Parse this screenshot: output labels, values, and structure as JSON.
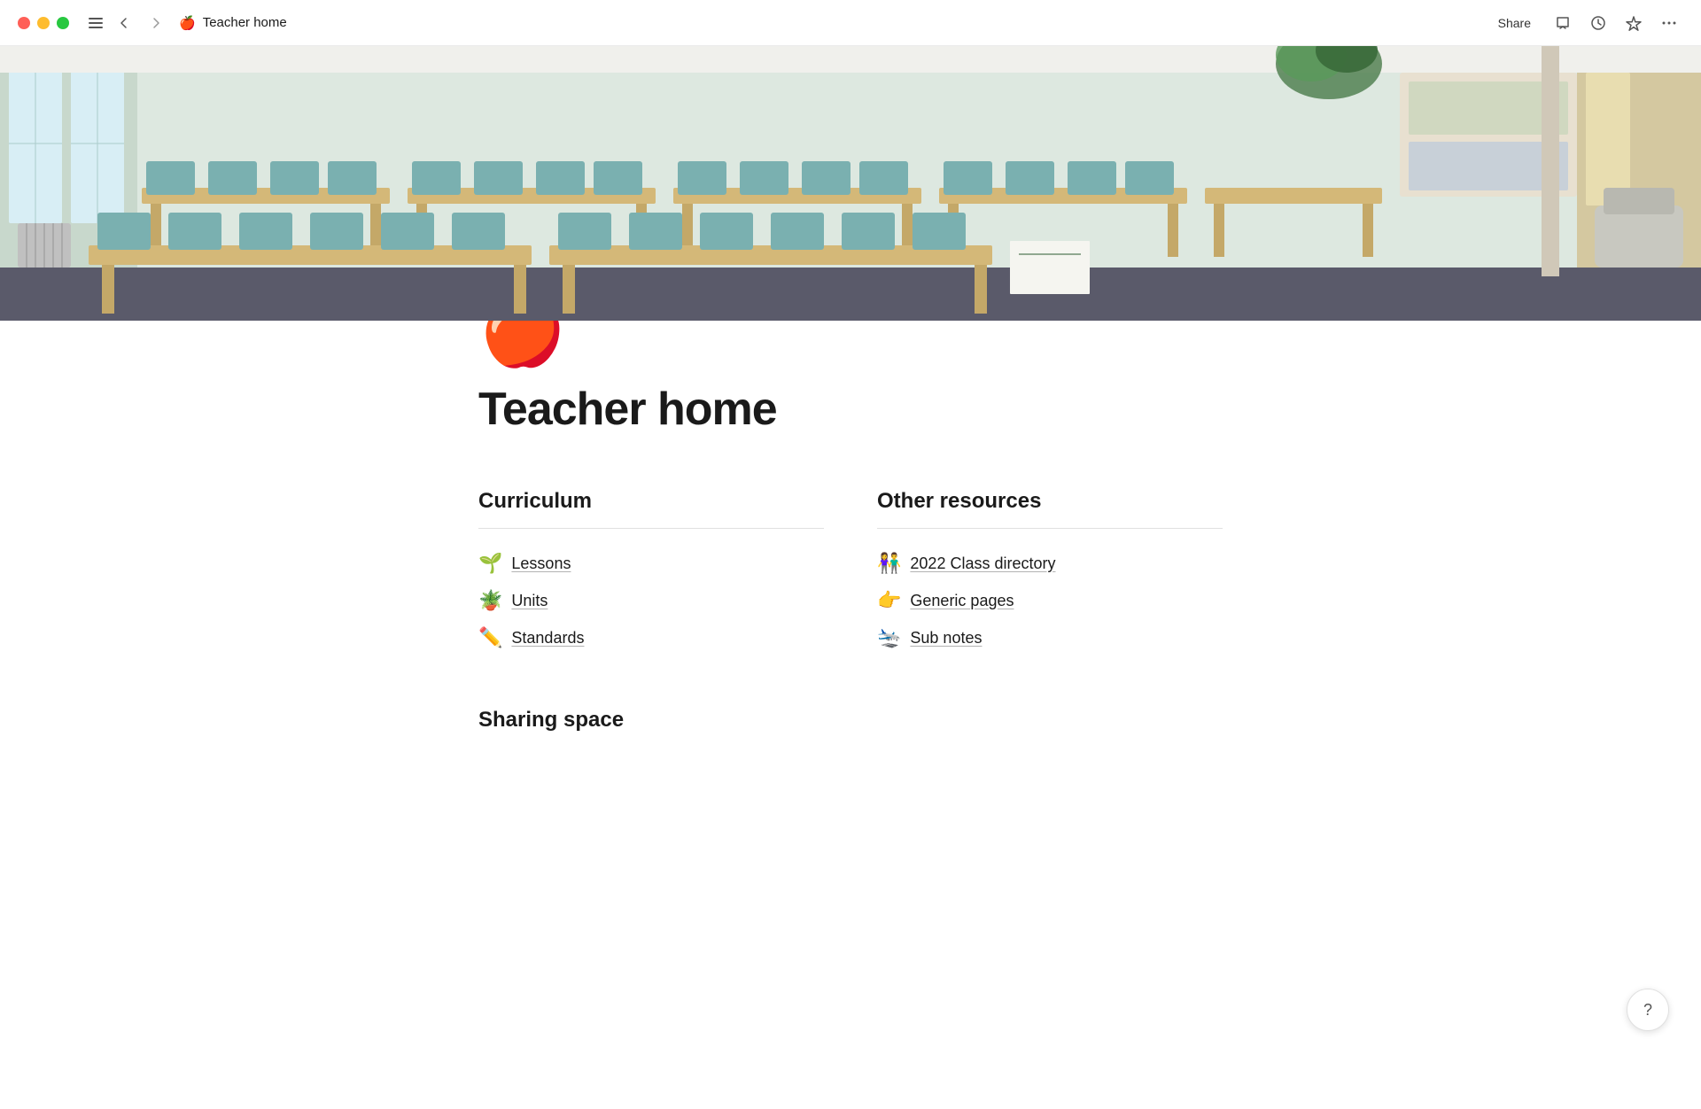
{
  "titleBar": {
    "title": "Teacher home",
    "emoji": "🍎",
    "shareLabel": "Share",
    "navBack": "←",
    "navForward": "→"
  },
  "page": {
    "emoji": "🍎",
    "title": "Teacher home"
  },
  "curriculum": {
    "heading": "Curriculum",
    "items": [
      {
        "emoji": "🌱",
        "label": "Lessons"
      },
      {
        "emoji": "🪴",
        "label": "Units"
      },
      {
        "emoji": "✏️",
        "label": "Standards"
      }
    ]
  },
  "otherResources": {
    "heading": "Other resources",
    "items": [
      {
        "emoji": "👫",
        "label": "2022 Class directory"
      },
      {
        "emoji": "👉",
        "label": "Generic pages"
      },
      {
        "emoji": "✈️",
        "label": "Sub notes"
      }
    ]
  },
  "sharingSpace": {
    "heading": "Sharing space"
  },
  "help": {
    "label": "?"
  }
}
